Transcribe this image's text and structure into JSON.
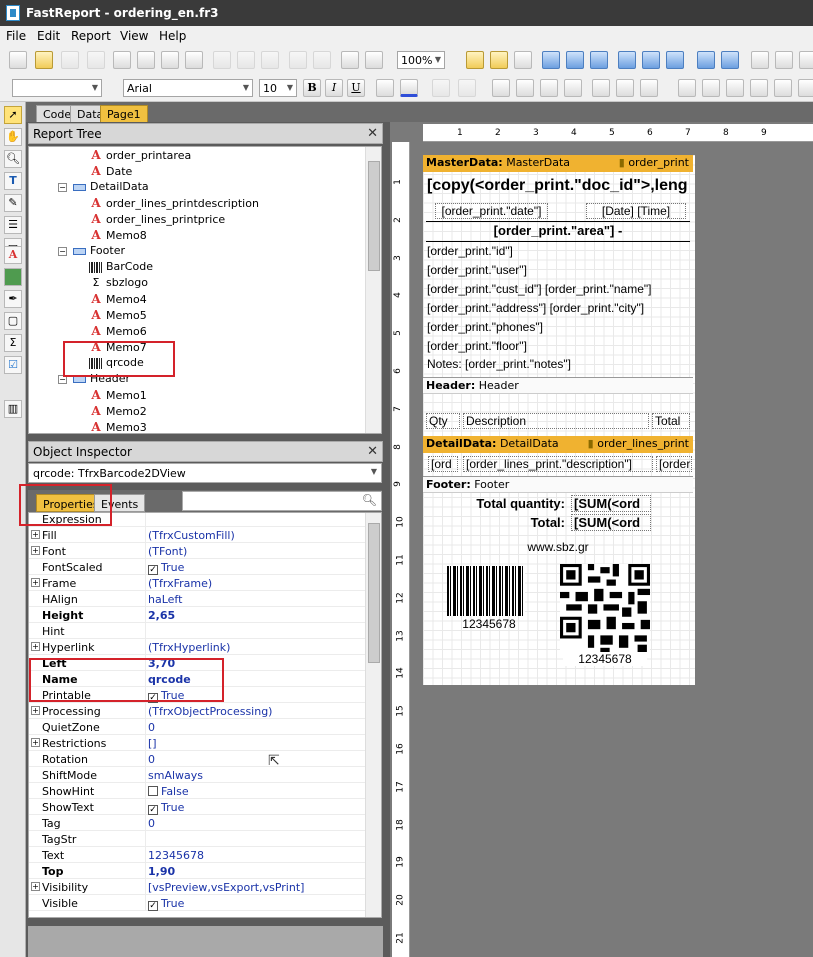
{
  "window": {
    "title": "FastReport - ordering_en.fr3"
  },
  "menu": [
    "File",
    "Edit",
    "Report",
    "View",
    "Help"
  ],
  "toolbar": {
    "zoom": "100%",
    "font_name": "Arial",
    "font_size": "10",
    "bold": "B",
    "italic": "I",
    "underline": "U"
  },
  "page_tabs": [
    "Code",
    "Data",
    "Page1"
  ],
  "report_tree": {
    "title": "Report Tree",
    "items": [
      {
        "label": "order_printarea",
        "type": "memo"
      },
      {
        "label": "Date",
        "type": "memo"
      },
      {
        "label": "DetailData",
        "type": "band"
      },
      {
        "label": "order_lines_printdescription",
        "type": "memo"
      },
      {
        "label": "order_lines_printprice",
        "type": "memo"
      },
      {
        "label": "Memo8",
        "type": "memo"
      },
      {
        "label": "Footer",
        "type": "band"
      },
      {
        "label": "BarCode",
        "type": "barcode"
      },
      {
        "label": "sbzlogo",
        "type": "sum"
      },
      {
        "label": "Memo4",
        "type": "memo"
      },
      {
        "label": "Memo5",
        "type": "memo"
      },
      {
        "label": "Memo6",
        "type": "memo"
      },
      {
        "label": "Memo7",
        "type": "memo"
      },
      {
        "label": "qrcode",
        "type": "barcode"
      },
      {
        "label": "Header",
        "type": "band"
      },
      {
        "label": "Memo1",
        "type": "memo"
      },
      {
        "label": "Memo2",
        "type": "memo"
      },
      {
        "label": "Memo3",
        "type": "memo"
      }
    ]
  },
  "inspector": {
    "title": "Object Inspector",
    "selected": "qrcode: TfrxBarcode2DView",
    "tabs": [
      "Properties",
      "Events"
    ],
    "rows": [
      {
        "name": "Expression",
        "value": "",
        "bold": false,
        "exp": false
      },
      {
        "name": "Fill",
        "value": "(TfrxCustomFill)",
        "bold": false,
        "exp": true
      },
      {
        "name": "Font",
        "value": "(TFont)",
        "bold": false,
        "exp": true
      },
      {
        "name": "FontScaled",
        "value": "True",
        "bold": false,
        "exp": false,
        "check": true
      },
      {
        "name": "Frame",
        "value": "(TfrxFrame)",
        "bold": false,
        "exp": true
      },
      {
        "name": "HAlign",
        "value": "haLeft",
        "bold": false,
        "exp": false
      },
      {
        "name": "Height",
        "value": "2,65",
        "bold": true,
        "exp": false
      },
      {
        "name": "Hint",
        "value": "",
        "bold": false,
        "exp": false
      },
      {
        "name": "Hyperlink",
        "value": "(TfrxHyperlink)",
        "bold": false,
        "exp": true
      },
      {
        "name": "Left",
        "value": "3,70",
        "bold": true,
        "exp": false
      },
      {
        "name": "Name",
        "value": "qrcode",
        "bold": true,
        "exp": false
      },
      {
        "name": "Printable",
        "value": "True",
        "bold": false,
        "exp": false,
        "check": true
      },
      {
        "name": "Processing",
        "value": "(TfrxObjectProcessing)",
        "bold": false,
        "exp": true
      },
      {
        "name": "QuietZone",
        "value": "0",
        "bold": false,
        "exp": false
      },
      {
        "name": "Restrictions",
        "value": "[]",
        "bold": false,
        "exp": true
      },
      {
        "name": "Rotation",
        "value": "0",
        "bold": false,
        "exp": false
      },
      {
        "name": "ShiftMode",
        "value": "smAlways",
        "bold": false,
        "exp": false
      },
      {
        "name": "ShowHint",
        "value": "False",
        "bold": false,
        "exp": false,
        "check": false
      },
      {
        "name": "ShowText",
        "value": "True",
        "bold": false,
        "exp": false,
        "check": true
      },
      {
        "name": "Tag",
        "value": "0",
        "bold": false,
        "exp": false
      },
      {
        "name": "TagStr",
        "value": "",
        "bold": false,
        "exp": false
      },
      {
        "name": "Text",
        "value": "12345678",
        "bold": false,
        "exp": false
      },
      {
        "name": "Top",
        "value": "1,90",
        "bold": true,
        "exp": false
      },
      {
        "name": "Visibility",
        "value": "[vsPreview,vsExport,vsPrint]",
        "bold": false,
        "exp": true
      },
      {
        "name": "Visible",
        "value": "True",
        "bold": false,
        "exp": false,
        "check": true
      }
    ]
  },
  "ruler": {
    "h": [
      "1",
      "2",
      "3",
      "4",
      "5",
      "6",
      "7",
      "8",
      "9"
    ],
    "v": [
      "1",
      "2",
      "3",
      "4",
      "5",
      "6",
      "7",
      "8",
      "9",
      "10",
      "11",
      "12",
      "13",
      "14",
      "15",
      "16",
      "17",
      "18",
      "19",
      "20",
      "21"
    ]
  },
  "report": {
    "master": {
      "band": "MasterData:",
      "name": "MasterData",
      "ds": "order_print",
      "title": "[copy(<order_print.\"doc_id\">,leng",
      "date": "[order_print.\"date\"]",
      "datetime": "[Date] [Time]",
      "area": "[order_print.\"area\"] -",
      "lines": [
        "[order_print.\"id\"]",
        "[order_print.\"user\"]",
        "[order_print.\"cust_id\"] [order_print.\"name\"]",
        "[order_print.\"address\"] [order_print.\"city\"]",
        "[order_print.\"phones\"]",
        "[order_print.\"floor\"]",
        "Notes: [order_print.\"notes\"]"
      ]
    },
    "header": {
      "band": "Header:",
      "name": "Header",
      "qty": "Qty",
      "desc": "Description",
      "total": "Total"
    },
    "detail": {
      "band": "DetailData:",
      "name": "DetailData",
      "ds": "order_lines_print",
      "c1": "[ord",
      "c2": "[order_lines_print.\"description\"]",
      "c3": "[order"
    },
    "footer": {
      "band": "Footer:",
      "name": "Footer",
      "tq": "Total quantity:",
      "tq_v": "[SUM(<ord",
      "t": "Total:",
      "t_v": "[SUM(<ord",
      "web": "www.sbz.gr",
      "bar_text": "12345678",
      "qr_text": "12345678"
    }
  }
}
